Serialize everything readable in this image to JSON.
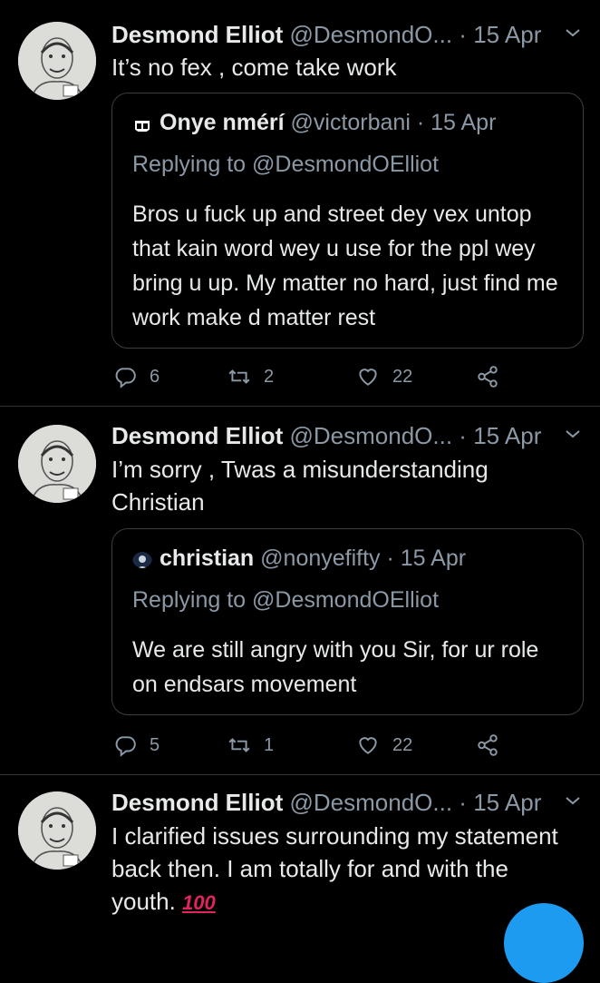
{
  "tweets": [
    {
      "author_name": "Desmond Elliot",
      "author_handle": "@DesmondO...",
      "separator": "·",
      "time": "15 Apr",
      "text": "It’s no fex , come take work",
      "quote": {
        "author_name": "Onye nmérí",
        "author_handle": "@victorbani",
        "separator": "·",
        "time": "15 Apr",
        "replying_to": "Replying to @DesmondOElliot",
        "text": "Bros u fuck up and street dey vex untop that kain word wey u use for the ppl wey bring u up. My matter no hard, just find me work make d matter rest"
      },
      "replies": "6",
      "retweets": "2",
      "likes": "22"
    },
    {
      "author_name": "Desmond Elliot",
      "author_handle": "@DesmondO...",
      "separator": "·",
      "time": "15 Apr",
      "text": "I’m sorry , Twas a misunderstanding Christian",
      "quote": {
        "author_name": "christian",
        "author_handle": "@nonyefifty",
        "separator": "·",
        "time": "15 Apr",
        "replying_to": "Replying to @DesmondOElliot",
        "text": "We are still angry with you Sir, for ur role on endsars movement"
      },
      "replies": "5",
      "retweets": "1",
      "likes": "22"
    },
    {
      "author_name": "Desmond Elliot",
      "author_handle": "@DesmondO...",
      "separator": "·",
      "time": "15 Apr",
      "text": "I clarified issues surrounding my statement back then. I am totally for and with the youth.",
      "emoji": "100"
    }
  ],
  "icons": {
    "reply": "reply-icon",
    "retweet": "retweet-icon",
    "like": "heart-icon",
    "share": "share-icon",
    "more": "chevron-down-icon"
  },
  "colors": {
    "background": "#000000",
    "text": "#e7e9ea",
    "secondary": "#8b98a5",
    "border": "#2f3336",
    "accent": "#1d9bf0"
  }
}
